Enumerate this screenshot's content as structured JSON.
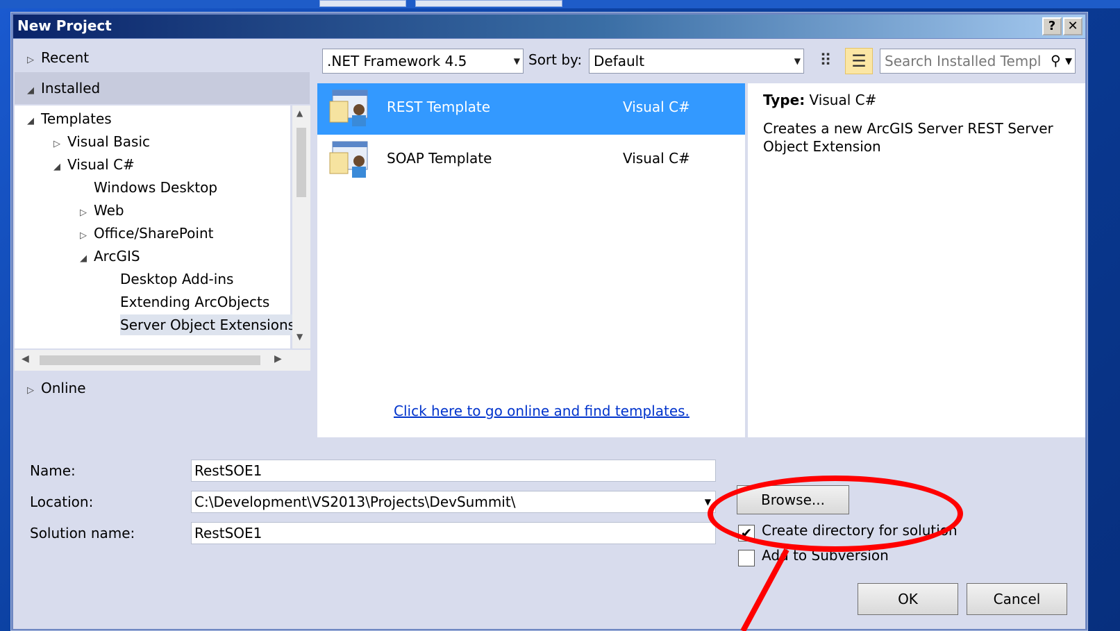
{
  "dialog": {
    "title": "New Project",
    "help_label": "?",
    "close_label": "✕"
  },
  "left": {
    "recent": "Recent",
    "installed": "Installed",
    "online": "Online",
    "tree": {
      "templates": "Templates",
      "visual_basic": "Visual Basic",
      "visual_csharp": "Visual C#",
      "windows_desktop": "Windows Desktop",
      "web": "Web",
      "office_sharepoint": "Office/SharePoint",
      "arcgis": "ArcGIS",
      "desktop_addins": "Desktop Add-ins",
      "extending_arcobjects": "Extending ArcObjects",
      "server_object_extensions": "Server Object Extensions"
    }
  },
  "toolbar": {
    "framework": ".NET Framework 4.5",
    "sort_label": "Sort by:",
    "sort_value": "Default",
    "search_placeholder": "Search Installed Templ"
  },
  "templates": [
    {
      "name": "REST Template",
      "language": "Visual C#",
      "selected": true
    },
    {
      "name": "SOAP Template",
      "language": "Visual C#",
      "selected": false
    }
  ],
  "online_link": "Click here to go online and find templates.",
  "details": {
    "type_label": "Type:",
    "type_value": "Visual C#",
    "description": "Creates a new ArcGIS Server REST Server Object Extension"
  },
  "form": {
    "name_label": "Name:",
    "name_value": "RestSOE1",
    "location_label": "Location:",
    "location_value": "C:\\Development\\VS2013\\Projects\\DevSummit\\",
    "solution_label": "Solution name:",
    "solution_value": "RestSOE1",
    "browse_label": "Browse...",
    "create_dir_label": "Create directory for solution",
    "create_dir_checked": true,
    "subversion_label": "Add to Subversion",
    "subversion_checked": false,
    "ok_label": "OK",
    "cancel_label": "Cancel"
  },
  "colors": {
    "selection": "#3399ff",
    "annotation": "#ff0000",
    "link": "#0033cc"
  }
}
